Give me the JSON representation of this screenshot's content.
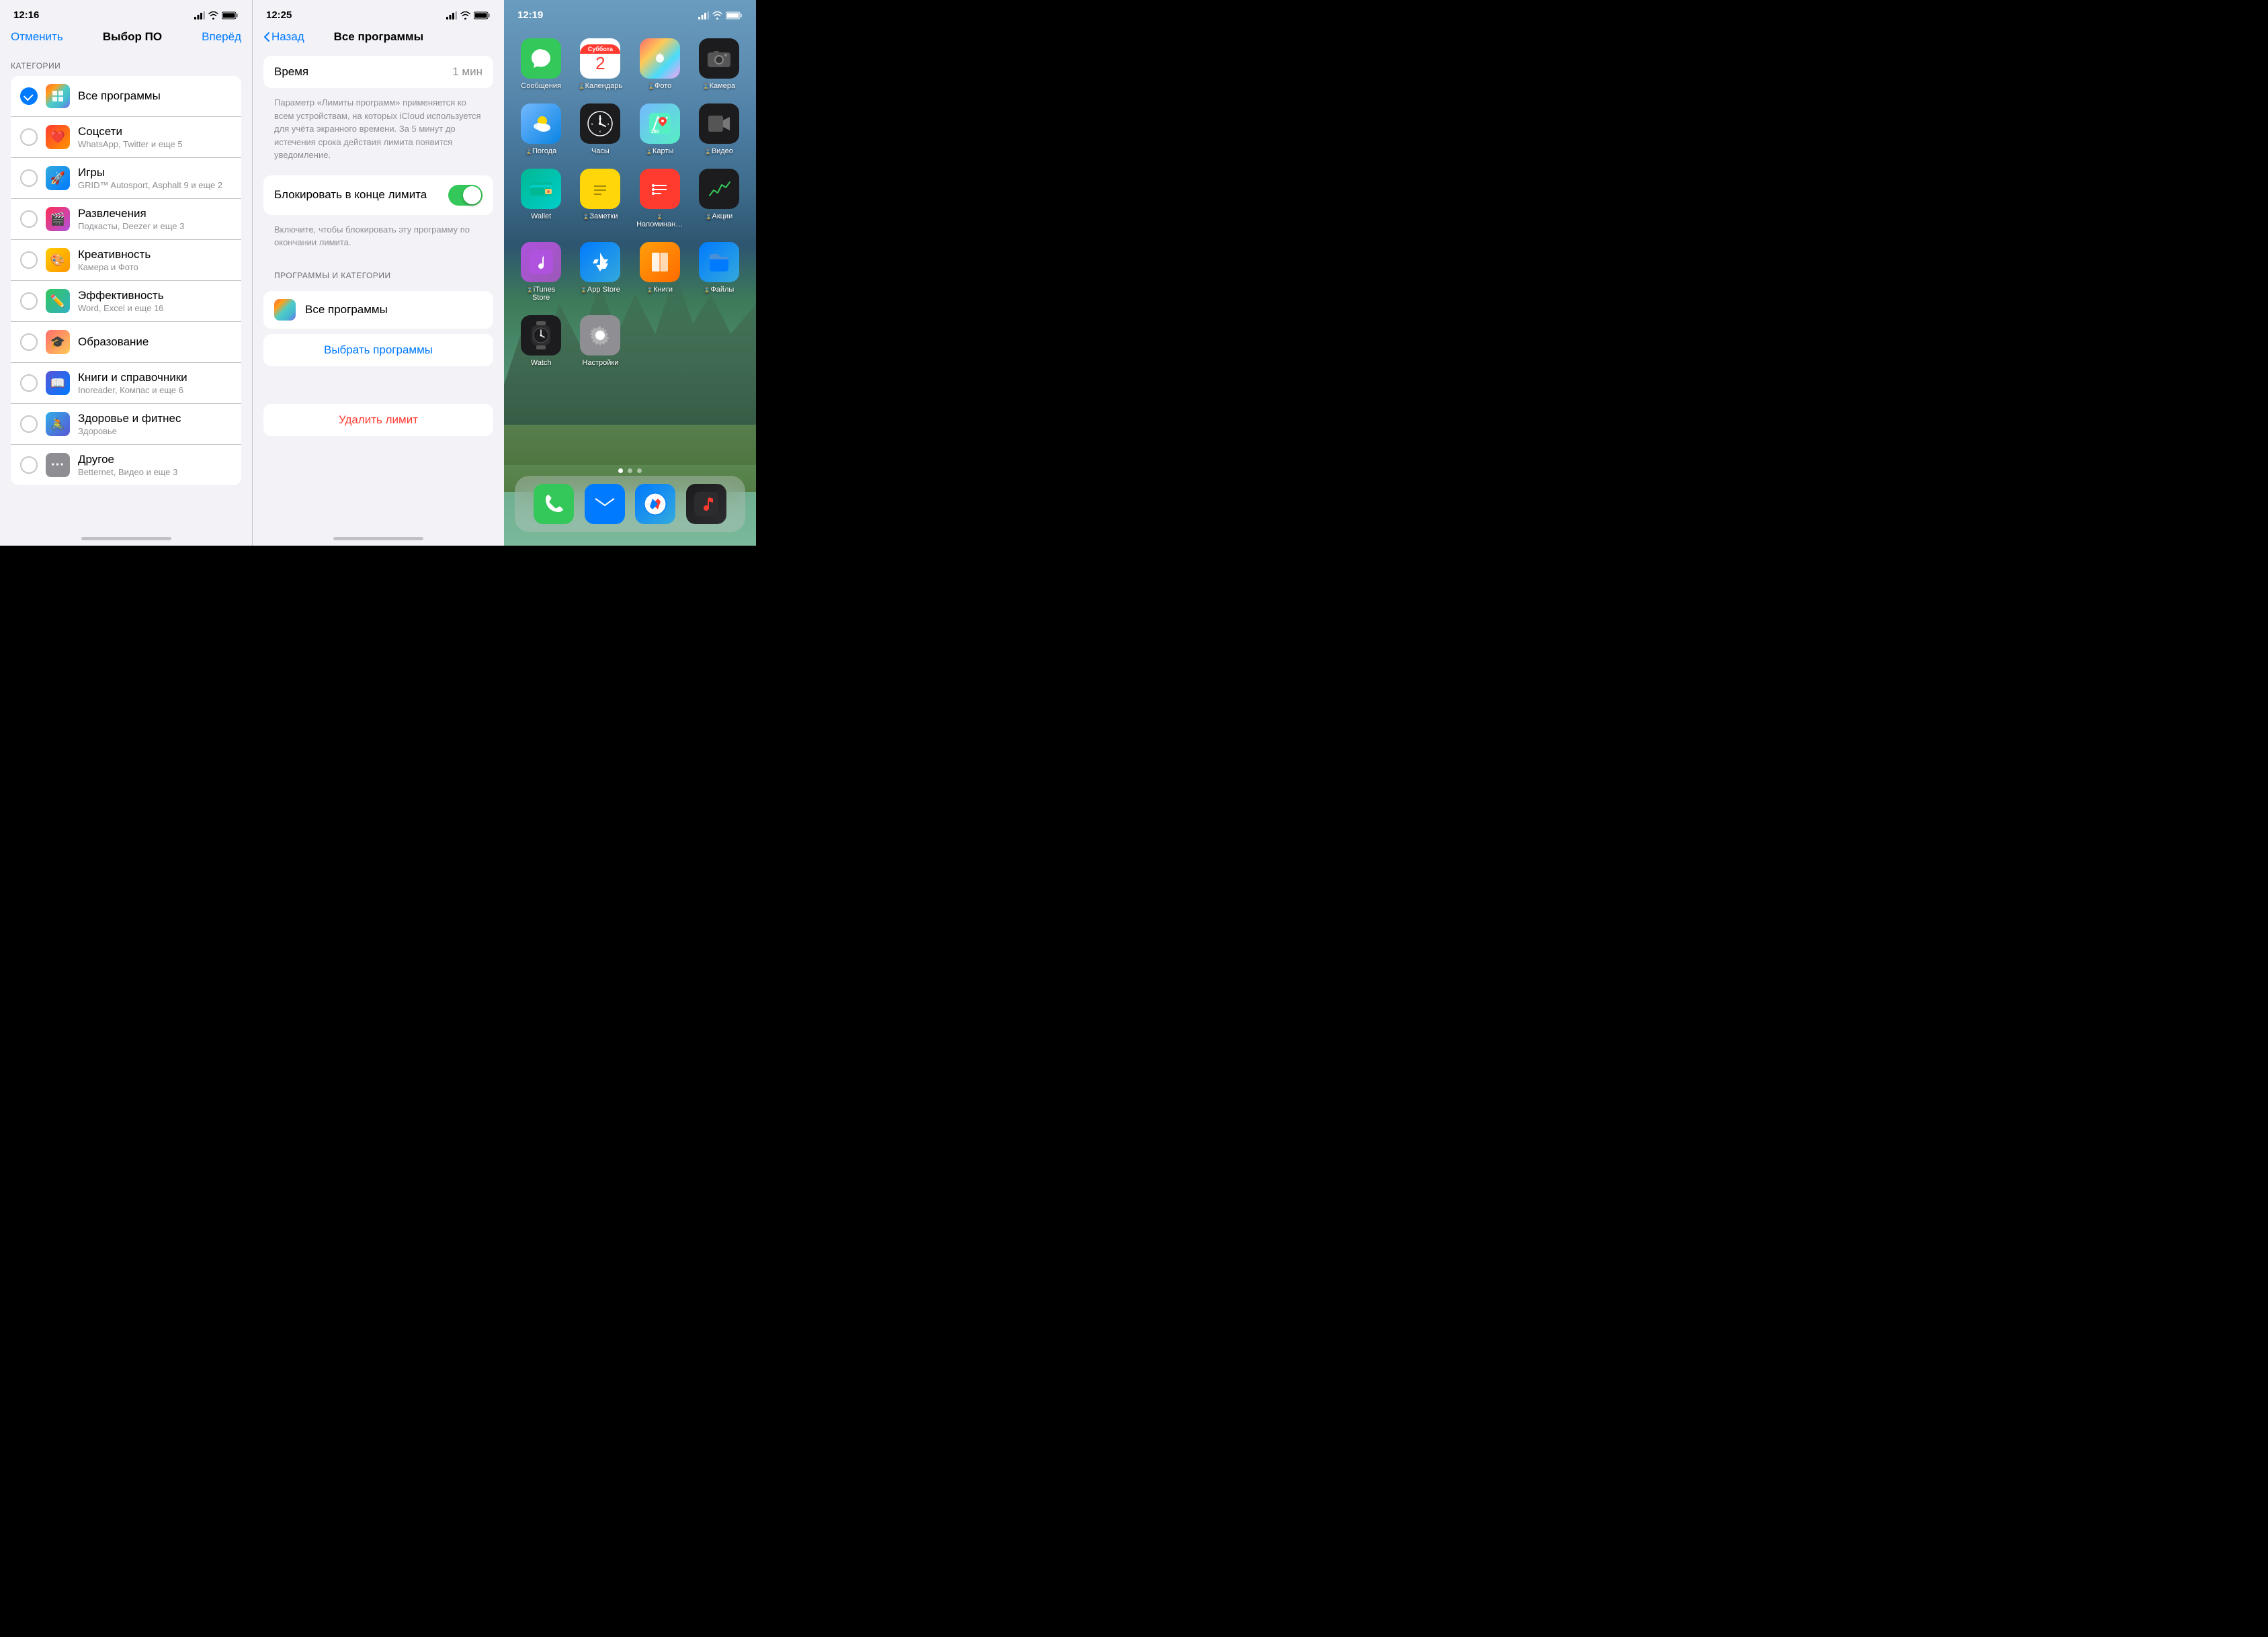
{
  "panel1": {
    "status_time": "12:16",
    "nav_cancel": "Отменить",
    "nav_title": "Выбор ПО",
    "nav_forward": "Вперёд",
    "section_header": "КАТЕГОРИИ",
    "categories": [
      {
        "id": "all",
        "label": "Все программы",
        "subtitle": "",
        "icon": "all",
        "checked": true
      },
      {
        "id": "social",
        "label": "Соцсети",
        "subtitle": "WhatsApp, Twitter и еще 5",
        "icon": "social",
        "checked": false
      },
      {
        "id": "games",
        "label": "Игры",
        "subtitle": "GRID™ Autosport, Asphalt 9 и еще 2",
        "icon": "games",
        "checked": false
      },
      {
        "id": "entertainment",
        "label": "Развлечения",
        "subtitle": "Подкасты, Deezer и еще 3",
        "icon": "entertainment",
        "checked": false
      },
      {
        "id": "creative",
        "label": "Креативность",
        "subtitle": "Камера и Фото",
        "icon": "creative",
        "checked": false
      },
      {
        "id": "productivity",
        "label": "Эффективность",
        "subtitle": "Word, Excel и еще 16",
        "icon": "productivity",
        "checked": false
      },
      {
        "id": "education",
        "label": "Образование",
        "subtitle": "",
        "icon": "education",
        "checked": false
      },
      {
        "id": "books",
        "label": "Книги и справочники",
        "subtitle": "Inoreader, Компас и еще 6",
        "icon": "books",
        "checked": false
      },
      {
        "id": "health",
        "label": "Здоровье и фитнес",
        "subtitle": "Здоровье",
        "icon": "health",
        "checked": false
      },
      {
        "id": "other",
        "label": "Другое",
        "subtitle": "Betternet, Видео и еще 3",
        "icon": "other",
        "checked": false
      }
    ]
  },
  "panel2": {
    "status_time": "12:25",
    "nav_back": "Назад",
    "nav_title": "Все программы",
    "time_label": "Время",
    "time_value": "1 мин",
    "info_text": "Параметр «Лимиты программ» применяется ко всем устройствам, на которых iCloud используется для учёта экранного времени. За 5 минут до истечения срока действия лимита появится уведомление.",
    "block_label": "Блокировать в конце лимита",
    "block_info": "Включите, чтобы блокировать эту программу по окончании лимита.",
    "section_header": "ПРОГРАММЫ И КАТЕГОРИИ",
    "app_name": "Все программы",
    "choose_apps": "Выбрать программы",
    "delete_limit": "Удалить лимит"
  },
  "panel3": {
    "status_time": "12:19",
    "apps": [
      {
        "id": "messages",
        "label": "Сообщения",
        "bg": "bg-messages",
        "icon": "💬",
        "restricted": false
      },
      {
        "id": "calendar",
        "label": "Календарь",
        "bg": "bg-calendar",
        "icon": "📅",
        "restricted": true,
        "calendar_day": "2",
        "calendar_dow": "Суббота"
      },
      {
        "id": "photos",
        "label": "Фото",
        "bg": "bg-photos",
        "icon": "🌸",
        "restricted": true
      },
      {
        "id": "camera",
        "label": "Камера",
        "bg": "bg-camera",
        "icon": "📷",
        "restricted": true
      },
      {
        "id": "weather",
        "label": "Погода",
        "bg": "bg-weather",
        "icon": "🌤",
        "restricted": true
      },
      {
        "id": "clock",
        "label": "Часы",
        "bg": "bg-clock",
        "icon": "🕐",
        "restricted": false
      },
      {
        "id": "maps",
        "label": "Карты",
        "bg": "bg-maps",
        "icon": "🗺",
        "restricted": true
      },
      {
        "id": "video",
        "label": "Видео",
        "bg": "bg-video",
        "icon": "🎬",
        "restricted": true
      },
      {
        "id": "wallet",
        "label": "Wallet",
        "bg": "bg-wallet",
        "icon": "💳",
        "restricted": false
      },
      {
        "id": "notes",
        "label": "Заметки",
        "bg": "bg-notes",
        "icon": "📝",
        "restricted": true
      },
      {
        "id": "reminders",
        "label": "Напоминан…",
        "bg": "bg-reminders",
        "icon": "🔔",
        "restricted": true
      },
      {
        "id": "stocks",
        "label": "Акции",
        "bg": "bg-stocks",
        "icon": "📈",
        "restricted": true
      },
      {
        "id": "itunes",
        "label": "iTunes Store",
        "bg": "bg-itunes",
        "icon": "🎵",
        "restricted": true
      },
      {
        "id": "appstore",
        "label": "App Store",
        "bg": "bg-appstore",
        "icon": "🅐",
        "restricted": true
      },
      {
        "id": "books",
        "label": "Книги",
        "bg": "bg-books",
        "icon": "📚",
        "restricted": true
      },
      {
        "id": "files",
        "label": "Файлы",
        "bg": "bg-files",
        "icon": "📁",
        "restricted": true
      },
      {
        "id": "watch",
        "label": "Watch",
        "bg": "bg-watch",
        "icon": "⌚",
        "restricted": false
      },
      {
        "id": "settings",
        "label": "Настройки",
        "bg": "bg-settings",
        "icon": "⚙️",
        "restricted": false
      }
    ],
    "dock": [
      {
        "id": "phone",
        "bg": "bg-phone",
        "icon": "📞"
      },
      {
        "id": "mail",
        "bg": "bg-mail",
        "icon": "✉️"
      },
      {
        "id": "safari",
        "bg": "bg-safari",
        "icon": "🧭"
      },
      {
        "id": "music",
        "bg": "bg-music",
        "icon": "🎵"
      }
    ]
  }
}
